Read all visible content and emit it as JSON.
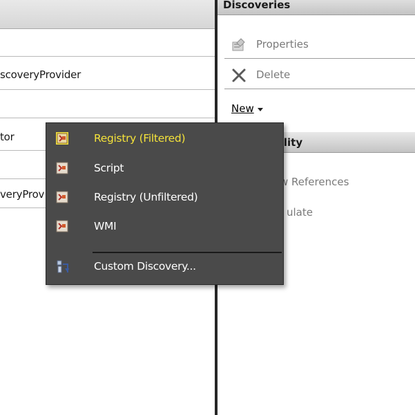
{
  "left_pane": {
    "rows": [
      {
        "text": "scoveryProvider"
      },
      {
        "text": "tor"
      },
      {
        "text": "veryProviderProperty"
      }
    ]
  },
  "right_pane": {
    "discoveries_header": "Discoveries",
    "actions": [
      {
        "label": "Properties",
        "icon": "properties-icon"
      },
      {
        "label": "Delete",
        "icon": "delete-icon"
      }
    ],
    "new_label": "New",
    "availability_header": "bility",
    "more_actions": [
      {
        "label": "w References"
      },
      {
        "label": "ulate"
      }
    ]
  },
  "context_menu": {
    "items": [
      {
        "label": "Registry (Filtered)",
        "icon": "registry-discovery-icon",
        "selected": true
      },
      {
        "label": "Script",
        "icon": "script-discovery-icon"
      },
      {
        "label": "Registry (Unfiltered)",
        "icon": "registry-discovery-icon"
      },
      {
        "label": "WMI",
        "icon": "wmi-discovery-icon"
      },
      {
        "label": "Custom Discovery...",
        "icon": "custom-discovery-icon"
      }
    ]
  },
  "colors": {
    "menu_bg": "#4a4a4a",
    "menu_text": "#ffffff",
    "menu_selected_text": "#f5e33a",
    "splitter": "#262626"
  }
}
